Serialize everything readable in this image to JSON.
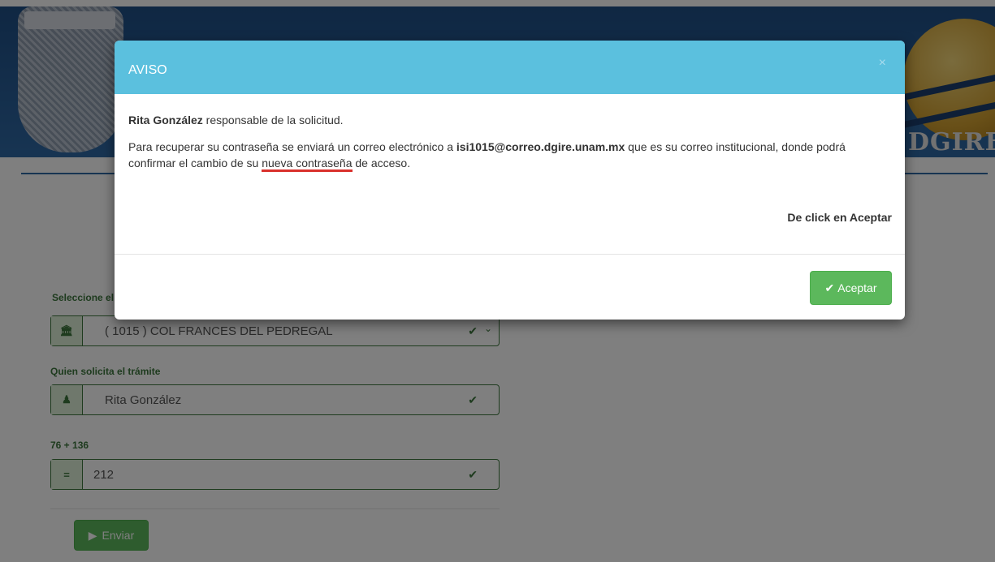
{
  "banner": {
    "logo_text": "DGIRE"
  },
  "form": {
    "school_label": "Seleccione el plantel",
    "school_value": "( 1015 ) COL FRANCES DEL PEDREGAL",
    "requester_label": "Quien solicita el trámite",
    "requester_value": "Rita González",
    "captcha_label": "76 + 136",
    "captcha_value": "212",
    "captcha_addon": "=",
    "submit_label": "Enviar"
  },
  "modal": {
    "title": "AVISO",
    "close": "×",
    "responsible_name": "Rita González",
    "responsible_text": " responsable de la solicitud.",
    "body_part1": "Para recuperar su contraseña se enviará un correo electrónico a ",
    "email": "isi1015@correo.dgire.unam.mx",
    "body_part2": " que es su correo institucional, donde podrá confirmar el cambio de su ",
    "highlight": "nueva contraseña",
    "body_part3": " de acceso.",
    "instruction": "De click en Aceptar",
    "accept_label": "Aceptar"
  },
  "icons": {
    "check": "✔",
    "caret": "⌄",
    "play": "▶",
    "user": "♟",
    "bank": "🏛"
  },
  "colors": {
    "header": "#5bc0de",
    "success": "#5cb85c",
    "form_green": "#3c763d",
    "banner": "#2f69a5",
    "highlight_underline": "#d9302c"
  }
}
